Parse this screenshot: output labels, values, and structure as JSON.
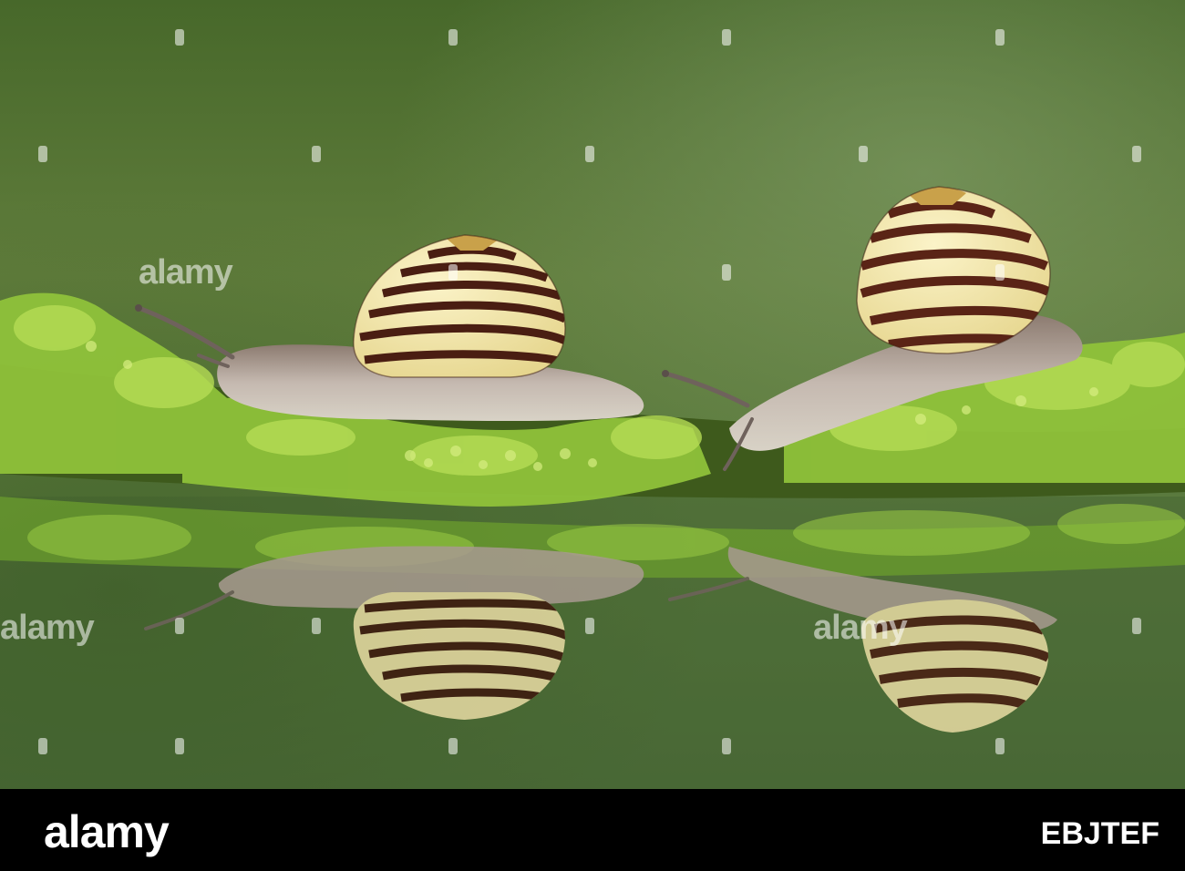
{
  "watermark": {
    "text": "alamy"
  },
  "footer": {
    "logo": "alamy",
    "image_id": "EBJTEF"
  },
  "colors": {
    "background_green": "#5f7a3a",
    "lichen": "#8fc23a",
    "shell_cream": "#f2e6b0",
    "shell_band": "#4a1e12",
    "snail_body": "#b9aca2",
    "footer_bg": "#000000"
  }
}
